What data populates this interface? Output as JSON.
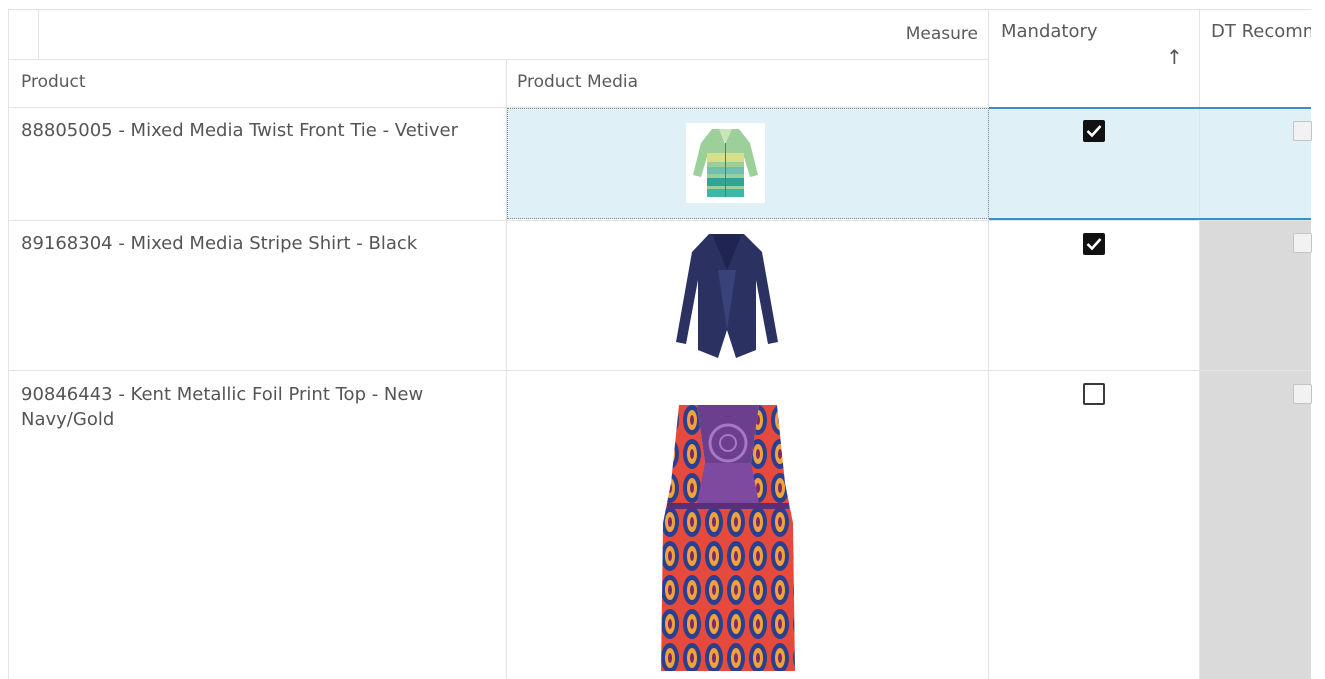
{
  "grid": {
    "corner_label": "Measure",
    "columns": {
      "product": "Product",
      "media": "Product Media",
      "mandatory": "Mandatory",
      "dt_recommended": "DT Recomm"
    },
    "sort_indicator": "↑",
    "rows": [
      {
        "product": "88805005 - Mixed Media Twist Front Tie - Vetiver",
        "media_icon": "green-striped-cardigan-image",
        "mandatory_checked": true,
        "dt_recommended_checked": false,
        "selected": true
      },
      {
        "product": "89168304 - Mixed Media Stripe Shirt - Black",
        "media_icon": "navy-cardigan-image",
        "mandatory_checked": true,
        "dt_recommended_checked": false,
        "selected": false
      },
      {
        "product_line1": "90846443 - Kent Metallic Foil Print Top - New",
        "product_line2": "Navy/Gold",
        "media_icon": "patterned-tank-top-image",
        "mandatory_checked": false,
        "dt_recommended_checked": false,
        "selected": false
      }
    ]
  },
  "colors": {
    "selected_row": "#dff0f7",
    "selected_border": "#3c8fc1",
    "disabled_column": "#dadada",
    "gridline": "#e3e3e3"
  }
}
